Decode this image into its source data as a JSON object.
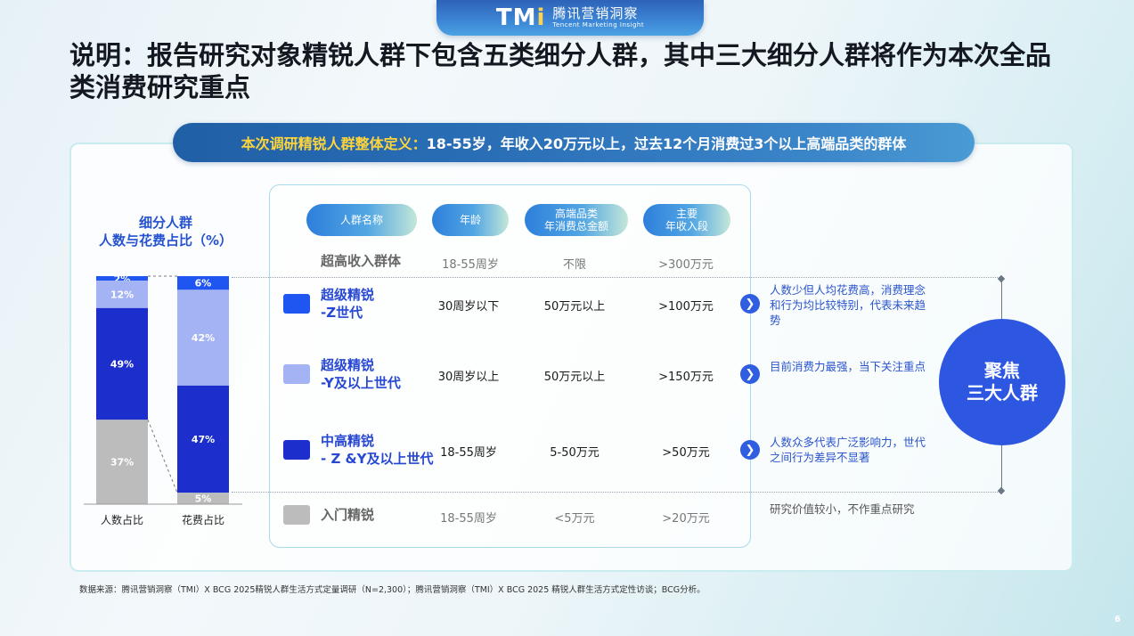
{
  "brand": {
    "mark": "TM",
    "mark_dot": "i",
    "name_cn": "腾讯营销洞察",
    "name_en": "Tencent Marketing Insight"
  },
  "title": "说明：报告研究对象精锐人群下包含五类细分人群，其中三大细分人群将作为本次全品类消费研究重点",
  "definition": {
    "label": "本次调研精锐人群整体定义：",
    "text": "18-55岁，年收入20万元以上，过去12个月消费过3个以上高端品类的群体"
  },
  "chart_title_line1": "细分人群",
  "chart_title_line2": "人数与花费占比（%）",
  "chart_data": {
    "type": "bar",
    "stacked": true,
    "unit": "%",
    "categories": [
      "人数占比",
      "花费占比"
    ],
    "series": [
      {
        "name": "超级精锐-Z世代",
        "color": "#1f55f0",
        "values": [
          2,
          6
        ]
      },
      {
        "name": "超级精锐-Y及以上世代",
        "color": "#a4b3f4",
        "values": [
          12,
          42
        ]
      },
      {
        "name": "中高精锐-Z&Y及以上世代",
        "color": "#1c2fcc",
        "values": [
          49,
          47
        ]
      },
      {
        "name": "入门精锐",
        "color": "#bcbcbc",
        "values": [
          37,
          5
        ]
      }
    ],
    "labels": [
      [
        "2%",
        "12%",
        "49%",
        "37%"
      ],
      [
        "6%",
        "42%",
        "47%",
        "5%"
      ]
    ]
  },
  "table": {
    "headers": [
      "人群名称",
      "年龄",
      "高端品类年消费总金额",
      "主要年收入段"
    ],
    "headers_lines": [
      [
        "人群名称"
      ],
      [
        "年龄"
      ],
      [
        "高端品类",
        "年消费总金额"
      ],
      [
        "主要",
        "年收入段"
      ]
    ],
    "top_row": {
      "name": "超高收入群体",
      "age": "18-55周岁",
      "spend": "不限",
      "income": ">300万元"
    },
    "rows": [
      {
        "name1": "超级精锐",
        "name2": "-Z世代",
        "age": "30周岁以下",
        "spend": "50万元以上",
        "income": ">100万元",
        "color": "#1f55f0",
        "note": "人数少但人均花费高，消费理念和行为均比较特别，代表未来趋势"
      },
      {
        "name1": "超级精锐",
        "name2": "-Y及以上世代",
        "age": "30周岁以上",
        "spend": "50万元以上",
        "income": ">150万元",
        "color": "#a4b3f4",
        "note": "目前消费力最强，当下关注重点"
      },
      {
        "name1": "中高精锐",
        "name2": "- Z &Y及以上世代",
        "age": "18-55周岁",
        "spend": "5-50万元",
        "income": ">50万元",
        "color": "#1c2fcc",
        "note": "人数众多代表广泛影响力，世代之间行为差异不显著"
      },
      {
        "name1": "入门精锐",
        "name2": "",
        "age": "18-55周岁",
        "spend": "<5万元",
        "income": ">20万元",
        "color": "#bcbcbc",
        "note": "研究价值较小，不作重点研究"
      }
    ]
  },
  "focus": {
    "line1": "聚焦",
    "line2": "三大人群"
  },
  "source": "数据来源：腾讯营销洞察（TMI）X BCG 2025精锐人群生活方式定量调研（N=2,300）；腾讯营销洞察（TMI）X BCG 2025 精锐人群生活方式定性访谈；BCG分析。",
  "page_number": "6"
}
